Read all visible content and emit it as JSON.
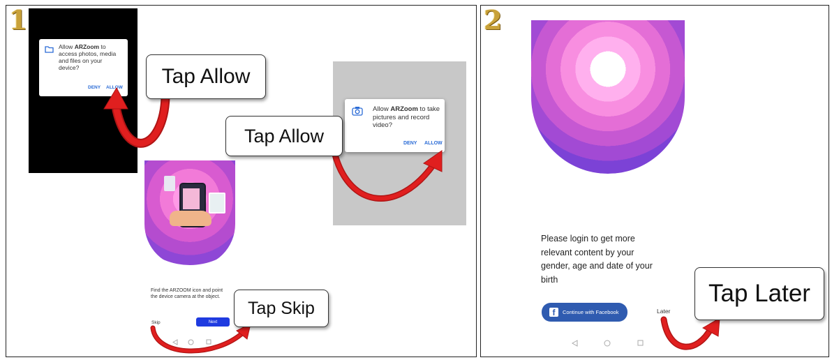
{
  "panel1": {
    "number": "1",
    "dialog_storage": {
      "prefix": "Allow ",
      "app": "ARZoom",
      "suffix_line1": " to",
      "line2": "access photos, media",
      "line3": "and files on your",
      "line4": "device?",
      "deny": "DENY",
      "allow": "ALLOW"
    },
    "dialog_camera": {
      "prefix": "Allow ",
      "app": "ARZoom",
      "suffix_line1": " to take",
      "line2": "pictures and record",
      "line3": "video?",
      "deny": "DENY",
      "allow": "ALLOW"
    },
    "callout_allow_1": "Tap Allow",
    "callout_allow_2": "Tap Allow",
    "callout_skip": "Tap Skip",
    "onboarding": {
      "line1": "Find the ARZOOM icon and point",
      "line2": "the device camera at the object.",
      "skip": "Skip",
      "next": "Next"
    }
  },
  "panel2": {
    "number": "2",
    "message_line1": "Please login to get more",
    "message_line2": "relevant content by your",
    "message_line3": "gender, age and date of your",
    "message_line4": "birth",
    "facebook_button": "Continue with Facebook",
    "later": "Later",
    "callout_later": "Tap Later"
  },
  "colors": {
    "accent_blue": "#2a6bd6",
    "facebook_blue": "#2f5bb0",
    "arrow_red": "#e01f1f",
    "next_button": "#1f3be0"
  },
  "icons": [
    "folder-icon",
    "camera-icon",
    "facebook-icon",
    "back-nav-icon",
    "home-nav-icon",
    "recents-nav-icon"
  ]
}
